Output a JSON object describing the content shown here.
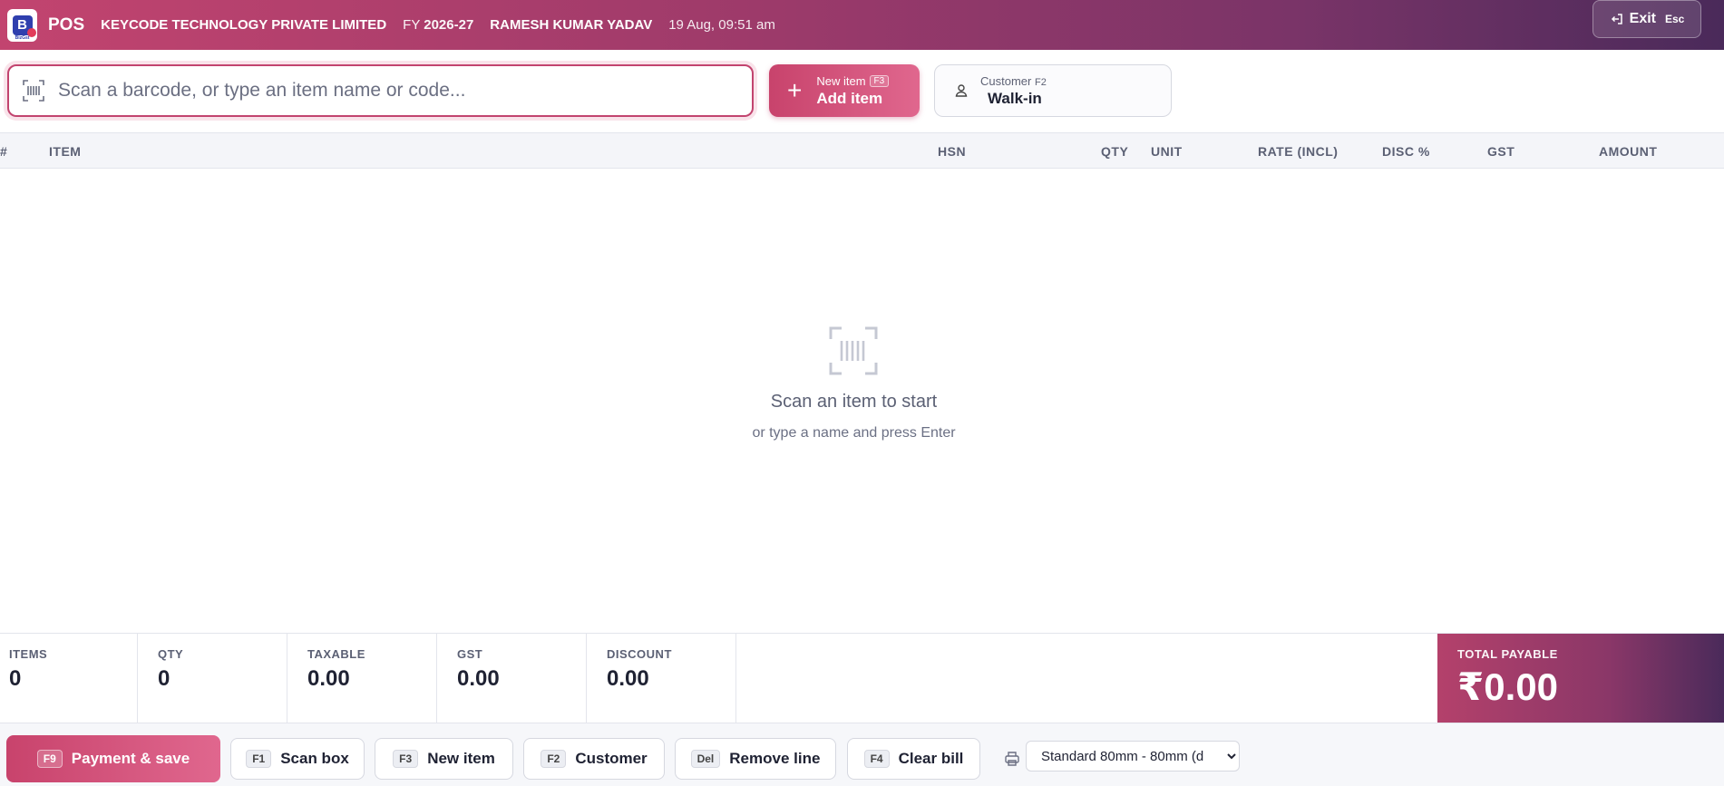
{
  "header": {
    "app_name": "POS",
    "company": "KEYCODE TECHNOLOGY PRIVATE LIMITED",
    "fy_label": "FY",
    "fy_value": "2026-27",
    "user": "RAMESH KUMAR YADAV",
    "datetime": "19 Aug, 09:51 am",
    "exit_label": "Exit",
    "exit_key": "Esc",
    "logo_text": "BizGst"
  },
  "search": {
    "placeholder": "Scan a barcode, or type an item name or code...",
    "value": ""
  },
  "add_item": {
    "small_label": "New item",
    "key": "F3",
    "label": "Add item"
  },
  "customer": {
    "small_label": "Customer",
    "key": "F2",
    "value": "Walk-in"
  },
  "table": {
    "columns": [
      "#",
      "ITEM",
      "HSN",
      "QTY",
      "UNIT",
      "RATE (INCL)",
      "DISC %",
      "GST",
      "AMOUNT"
    ],
    "rows": []
  },
  "empty_state": {
    "title": "Scan an item to start",
    "subtitle": "or type a name and press Enter"
  },
  "summary": {
    "items_label": "ITEMS",
    "items_value": "0",
    "qty_label": "QTY",
    "qty_value": "0",
    "taxable_label": "TAXABLE",
    "taxable_value": "0.00",
    "gst_label": "GST",
    "gst_value": "0.00",
    "discount_label": "DISCOUNT",
    "discount_value": "0.00",
    "total_label": "TOTAL PAYABLE",
    "total_value": "₹0.00"
  },
  "actions": {
    "payment": {
      "key": "F9",
      "label": "Payment & save"
    },
    "scan_box": {
      "key": "F1",
      "label": "Scan box"
    },
    "new_item": {
      "key": "F3",
      "label": "New item"
    },
    "customer": {
      "key": "F2",
      "label": "Customer"
    },
    "remove_line": {
      "key": "Del",
      "label": "Remove line"
    },
    "clear_bill": {
      "key": "F4",
      "label": "Clear bill"
    },
    "print_format": "Standard 80mm - 80mm (d"
  },
  "colors": {
    "accent": "#c2446f",
    "header_end": "#4a2a5a"
  }
}
